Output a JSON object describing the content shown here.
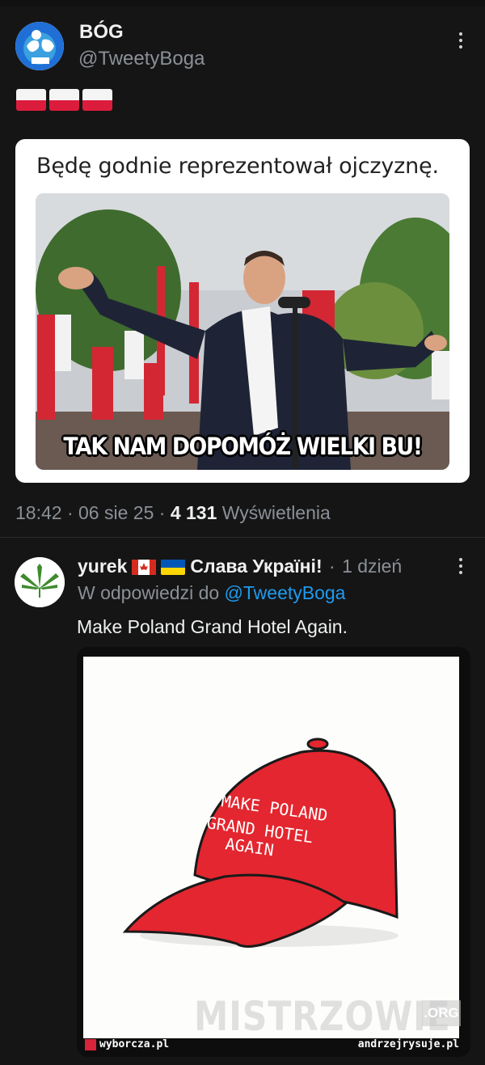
{
  "tweet": {
    "author_name": "BÓG",
    "author_handle": "@TweetyBoga",
    "flag_count": 3,
    "card": {
      "text": "Będę godnie reprezentował ojczyznę.",
      "caption": "TAK NAM DOPOMÓŻ WIELKI BU!"
    },
    "time": "18:42",
    "date": "06 sie 25",
    "views": "4 131",
    "views_label": "Wyświetlenia"
  },
  "reply": {
    "author_name": "yurek",
    "author_tagline": "Слава Україні!",
    "age": "1 dzień",
    "replying_to_prefix": "W odpowiedzi do",
    "replying_to": "@TweetyBoga",
    "text": "Make Poland Grand Hotel Again.",
    "comic": {
      "cap_text_1": "MAKE POLAND",
      "cap_text_2": "GRAND HOTEL",
      "cap_text_3": "AGAIN",
      "footer_left": "wyborcza.pl",
      "footer_right": "andrzejrysuje.pl"
    }
  },
  "watermark": {
    "text": "MISTRZOWIE",
    "badge": ".ORG"
  },
  "colors": {
    "background": "#151515",
    "link": "#1d9bf0",
    "muted": "#8b9097",
    "flag_red": "#dc1c3c",
    "cap_red": "#e3262f"
  }
}
